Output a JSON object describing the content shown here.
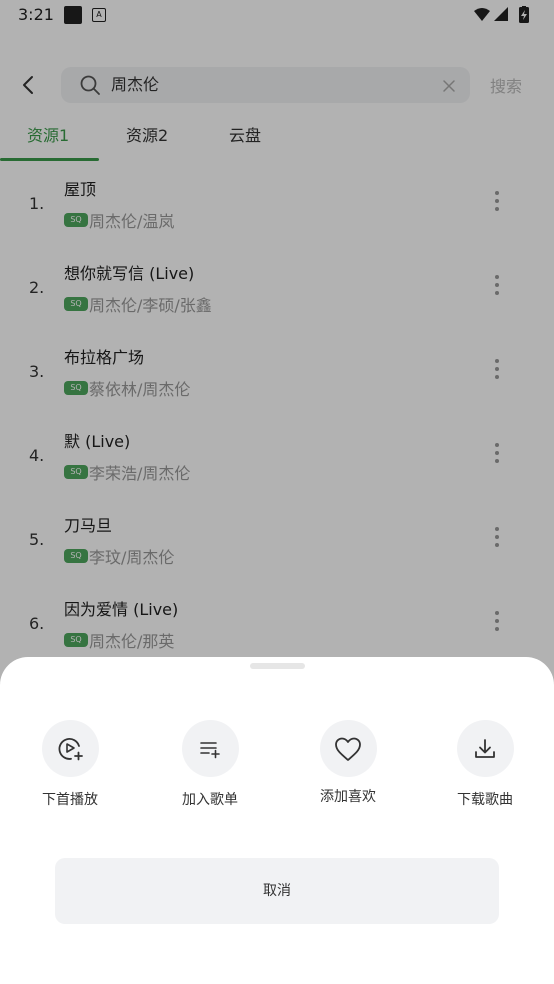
{
  "status_bar": {
    "time": "3:21",
    "notification_glyph": "A"
  },
  "header": {
    "search_value": "周杰伦",
    "search_button": "搜索"
  },
  "tabs": [
    {
      "label": "资源1",
      "active": true
    },
    {
      "label": "资源2",
      "active": false
    },
    {
      "label": "云盘",
      "active": false
    }
  ],
  "songs": [
    {
      "index": "1.",
      "title": "屋顶",
      "badge": "SQ",
      "artist": "周杰伦/温岚"
    },
    {
      "index": "2.",
      "title": "想你就写信 (Live)",
      "badge": "SQ",
      "artist": "周杰伦/李硕/张鑫"
    },
    {
      "index": "3.",
      "title": "布拉格广场",
      "badge": "SQ",
      "artist": "蔡依林/周杰伦"
    },
    {
      "index": "4.",
      "title": "默 (Live)",
      "badge": "SQ",
      "artist": "李荣浩/周杰伦"
    },
    {
      "index": "5.",
      "title": "刀马旦",
      "badge": "SQ",
      "artist": "李玟/周杰伦"
    },
    {
      "index": "6.",
      "title": "因为爱情 (Live)",
      "badge": "SQ",
      "artist": "周杰伦/那英"
    }
  ],
  "sheet": {
    "actions": [
      {
        "label": "下首播放",
        "icon": "play-next-icon"
      },
      {
        "label": "加入歌单",
        "icon": "add-to-playlist-icon"
      },
      {
        "label": "添加喜欢",
        "icon": "heart-icon"
      },
      {
        "label": "下载歌曲",
        "icon": "download-icon"
      }
    ],
    "cancel": "取消"
  },
  "colors": {
    "accent": "#3a9a49",
    "badge": "#4ea65e",
    "overlay": "rgba(0,0,0,0.30)"
  }
}
